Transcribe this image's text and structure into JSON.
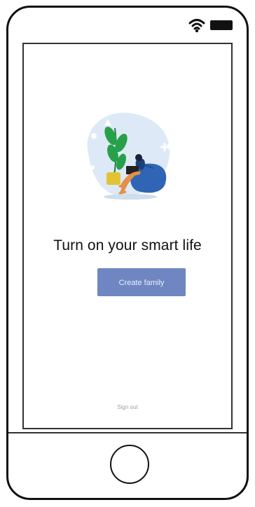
{
  "status_bar": {
    "wifi_icon": "wifi-icon",
    "battery_icon": "battery-icon"
  },
  "onboarding": {
    "headline": "Turn on your smart life",
    "create_button_label": "Create family",
    "footer_link_label": "Sign out"
  },
  "colors": {
    "button": "#6f86c2",
    "illustration_blob": "#dde9f7",
    "plant": "#27a04a",
    "beanbag": "#2f65b4",
    "person_skin": "#e58f47"
  },
  "icons": {
    "home_button": "home-button-icon"
  }
}
